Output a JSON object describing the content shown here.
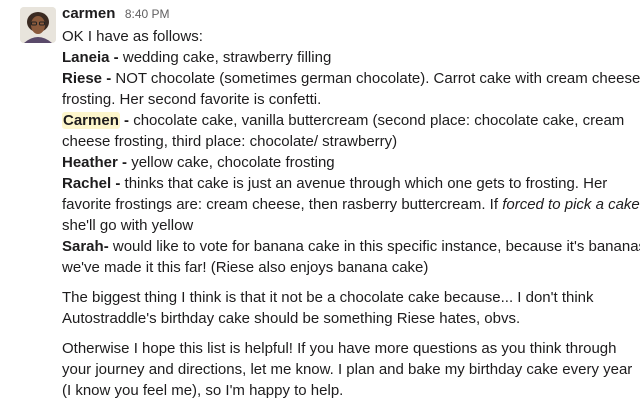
{
  "message": {
    "author": "carmen",
    "time": "8:40 PM",
    "intro": "OK I have as follows:",
    "entries": [
      {
        "name": "Laneia -",
        "text": " wedding cake, strawberry filling"
      },
      {
        "name": "Riese -",
        "text": " NOT chocolate (sometimes german chocolate). Carrot cake with cream cheese",
        "line2": "frosting. Her second favorite is confetti."
      },
      {
        "name": "Carmen",
        "dash": " -",
        "text": " chocolate cake, vanilla buttercream (second place: chocolate cake, cream",
        "line2": "cheese frosting, third place: chocolate/ strawberry)"
      },
      {
        "name": "Heather -",
        "text": " yellow cake, chocolate frosting"
      },
      {
        "name": "Rachel -",
        "text": " thinks that cake is just an avenue through which one gets to frosting. Her",
        "line2a": "favorite frostings are: cream cheese, then rasberry buttercream. If ",
        "line2_italic": "forced to pick a cake",
        "line2b": ",",
        "line3": "she'll go with yellow"
      },
      {
        "name": "Sarah-",
        "text": " would like to vote for banana cake in this specific instance, because it's bananas",
        "line2": "we've made it this far! (Riese also enjoys banana cake)"
      }
    ],
    "paragraph1": [
      "The biggest thing I think is that it not be a chocolate cake because... I don't think",
      "Autostraddle's birthday cake should be something Riese hates, obvs."
    ],
    "paragraph2": [
      "Otherwise I hope this list is helpful! If you have more questions as you think through",
      "your journey and directions, let me know. I plan and bake my birthday cake every year",
      "(I know you feel me), so I'm happy to help."
    ]
  }
}
